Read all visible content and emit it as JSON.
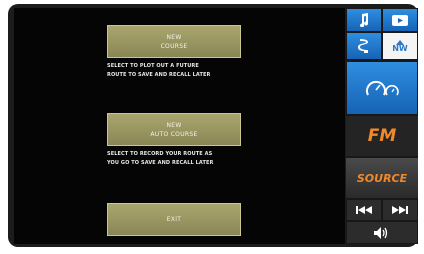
{
  "menu": {
    "new_course": {
      "line1": "NEW",
      "line2": "COURSE"
    },
    "new_course_desc": [
      "SELECT TO PLOT OUT A FUTURE",
      "ROUTE TO SAVE AND RECALL LATER"
    ],
    "new_auto_course": {
      "line1": "NEW",
      "line2": "AUTO COURSE"
    },
    "new_auto_course_desc": [
      "SELECT TO RECORD YOUR ROUTE AS",
      "YOU GO TO SAVE AND RECALL LATER"
    ],
    "exit_label": "EXIT"
  },
  "sidebar": {
    "music_icon": "music-note-icon",
    "video_icon": "video-icon",
    "nav_icon": "navigation-icon",
    "compass_label": "NW",
    "gauges_icon": "gauges-icon",
    "band_label": "FM",
    "source_label": "SOURCE",
    "prev_icon": "previous-track-icon",
    "next_icon": "next-track-icon",
    "volume_icon": "volume-icon"
  },
  "colors": {
    "accent_blue": "#1f7ad0",
    "accent_orange": "#ef8a2a",
    "button_olive": "#9a976a"
  }
}
